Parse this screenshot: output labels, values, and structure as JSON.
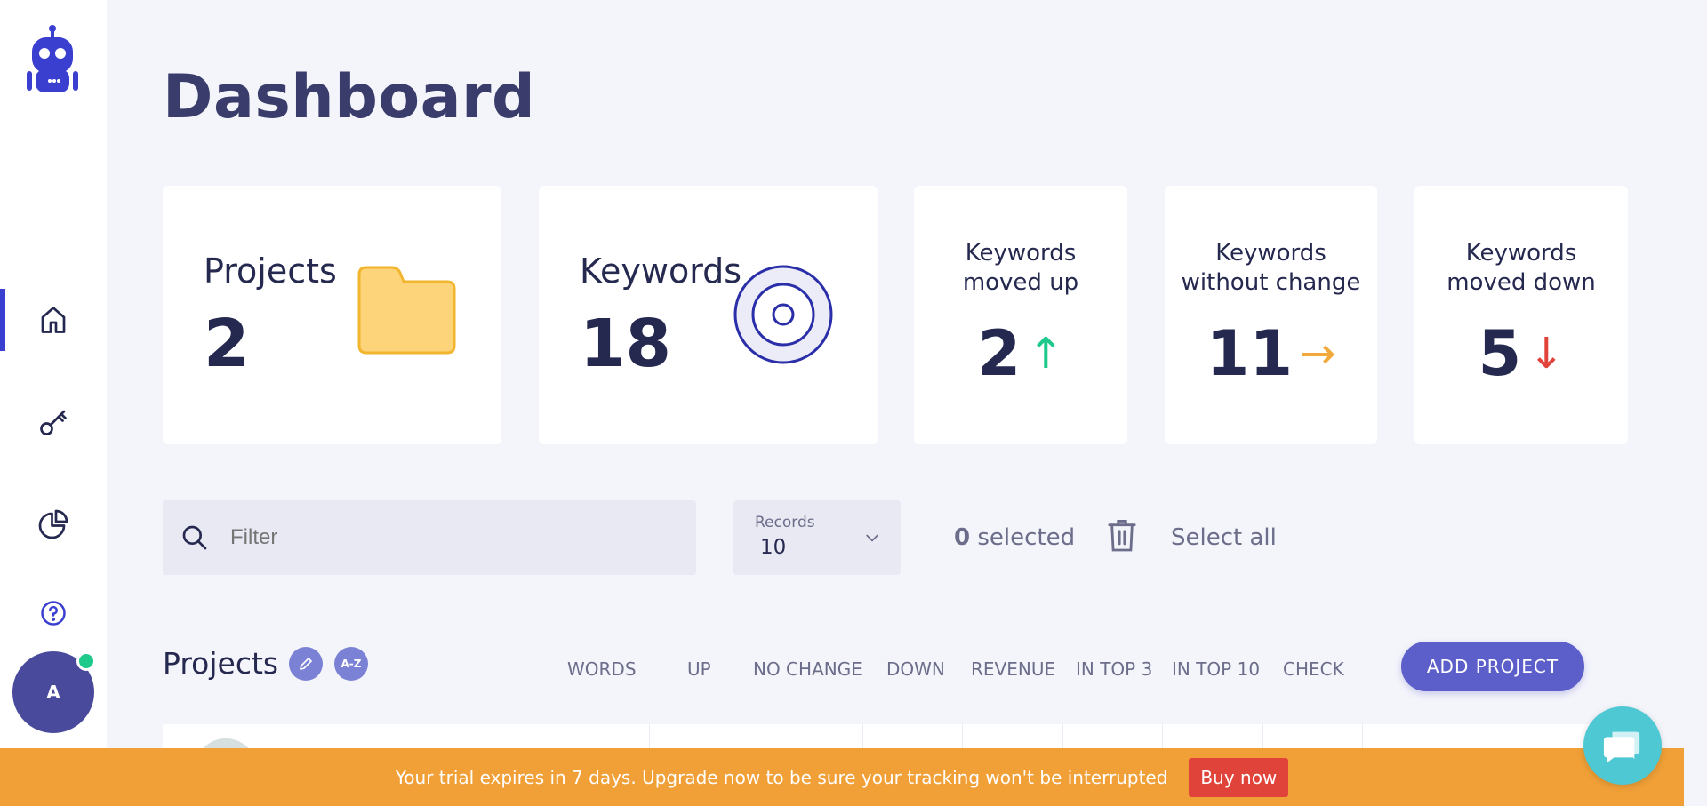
{
  "page": {
    "title": "Dashboard"
  },
  "sidebar": {
    "items": [
      {
        "icon": "home-icon",
        "active": true
      },
      {
        "icon": "key-icon",
        "active": false
      },
      {
        "icon": "pie-chart-icon",
        "active": false
      },
      {
        "icon": "help-icon",
        "active": false
      }
    ],
    "avatar_initial": "A"
  },
  "stats": {
    "projects": {
      "label": "Projects",
      "value": "2"
    },
    "keywords": {
      "label": "Keywords",
      "value": "18"
    },
    "moved_up": {
      "label_line1": "Keywords",
      "label_line2": "moved up",
      "value": "2",
      "arrow": "↑",
      "color": "#1ec98b"
    },
    "no_change": {
      "label_line1": "Keywords",
      "label_line2": "without change",
      "value": "11",
      "arrow": "→",
      "color": "#f2a93b"
    },
    "moved_down": {
      "label_line1": "Keywords",
      "label_line2": "moved down",
      "value": "5",
      "arrow": "↓",
      "color": "#e0433a"
    }
  },
  "toolbar": {
    "filter_placeholder": "Filter",
    "records_label": "Records",
    "records_value": "10",
    "selected_count": "0",
    "selected_suffix": " selected",
    "select_all": "Select all"
  },
  "projects_table": {
    "title": "Projects",
    "az_label": "A-Z",
    "columns": [
      "WORDS",
      "UP",
      "NO CHANGE",
      "DOWN",
      "REVENUE",
      "IN TOP 3",
      "IN TOP 10",
      "CHECK"
    ],
    "add_button": "ADD PROJECT"
  },
  "trial_banner": {
    "text": "Your trial expires in 7 days. Upgrade now to be sure your tracking won't be interrupted",
    "button": "Buy now"
  },
  "colors": {
    "accent": "#3b3fd0",
    "button": "#5c5fc9",
    "banner": "#f0a037",
    "buy": "#e0433a",
    "chat": "#4ec8d3"
  }
}
